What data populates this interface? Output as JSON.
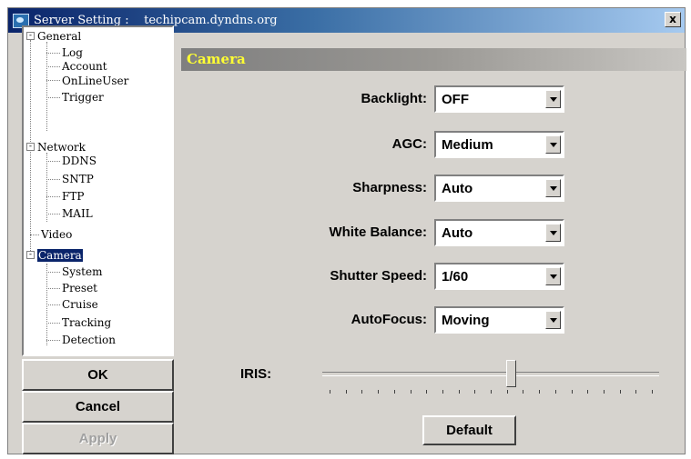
{
  "window": {
    "title": "Server Setting :    techipcam.dyndns.org",
    "close_label": "x"
  },
  "tree": {
    "items": [
      {
        "label": "General"
      },
      {
        "label": "Log"
      },
      {
        "label": "Account"
      },
      {
        "label": "OnLineUser"
      },
      {
        "label": "Trigger"
      },
      {
        "label": "Network"
      },
      {
        "label": "DDNS"
      },
      {
        "label": "SNTP"
      },
      {
        "label": "FTP"
      },
      {
        "label": "MAIL"
      },
      {
        "label": "Video"
      },
      {
        "label": "Camera"
      },
      {
        "label": "System"
      },
      {
        "label": "Preset"
      },
      {
        "label": "Cruise"
      },
      {
        "label": "Tracking"
      },
      {
        "label": "Detection"
      }
    ],
    "selected": "Camera"
  },
  "buttons": {
    "ok": "OK",
    "cancel": "Cancel",
    "apply": "Apply",
    "default": "Default"
  },
  "section": {
    "title": "Camera"
  },
  "fields": [
    {
      "label": "Backlight:",
      "value": "OFF"
    },
    {
      "label": "AGC:",
      "value": "Medium"
    },
    {
      "label": "Sharpness:",
      "value": "Auto"
    },
    {
      "label": "White Balance:",
      "value": "Auto"
    },
    {
      "label": "Shutter Speed:",
      "value": "1/60"
    },
    {
      "label": "AutoFocus:",
      "value": "Moving"
    }
  ],
  "iris": {
    "label": "IRIS:",
    "position": 0.56
  }
}
